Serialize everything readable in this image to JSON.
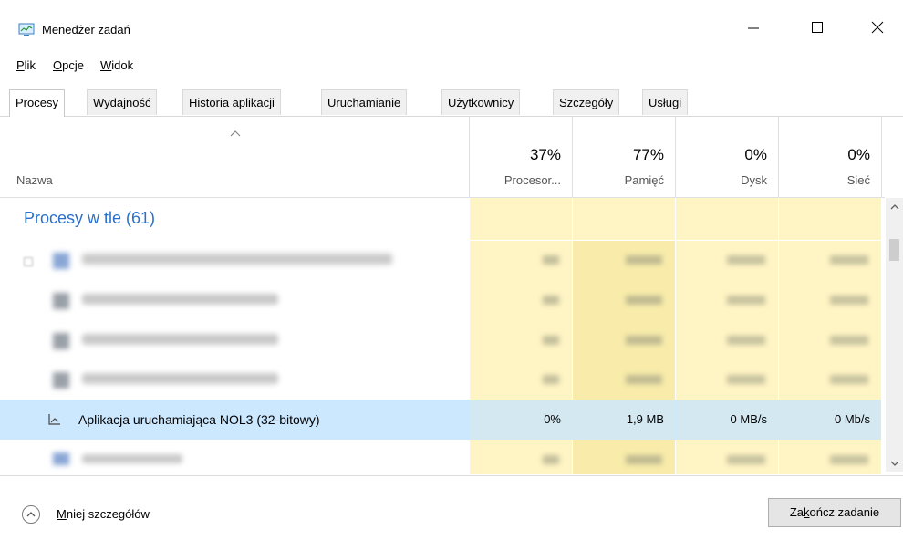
{
  "window": {
    "title": "Menedżer zadań",
    "controls": [
      "minimize-icon",
      "maximize-icon",
      "close-icon"
    ]
  },
  "menu": {
    "items": [
      {
        "label": "Plik",
        "accel": "P",
        "rest": "lik"
      },
      {
        "label": "Opcje",
        "accel": "O",
        "rest": "pcje"
      },
      {
        "label": "Widok",
        "accel": "W",
        "rest": "idok"
      }
    ]
  },
  "tabs": [
    {
      "label": "Procesy",
      "active": true
    },
    {
      "label": "Wydajność"
    },
    {
      "label": "Historia aplikacji"
    },
    {
      "label": "Uruchamianie"
    },
    {
      "label": "Użytkownicy"
    },
    {
      "label": "Szczegóły"
    },
    {
      "label": "Usługi"
    }
  ],
  "columns": {
    "name": {
      "label": "Nazwa"
    },
    "cpu": {
      "percent": "37%",
      "label": "Procesor..."
    },
    "memory": {
      "percent": "77%",
      "label": "Pamięć"
    },
    "disk": {
      "percent": "0%",
      "label": "Dysk"
    },
    "network": {
      "percent": "0%",
      "label": "Sieć"
    }
  },
  "group": {
    "label": "Procesy w tle (61)"
  },
  "rows": [
    {
      "name": "blurred-row-1",
      "blurred": true
    },
    {
      "name": "blurred-row-2",
      "blurred": true
    },
    {
      "name": "blurred-row-3",
      "blurred": true
    },
    {
      "name": "blurred-row-4",
      "blurred": true
    },
    {
      "name": "Aplikacja uruchamiająca NOL3 (32-bitowy)",
      "cpu": "0%",
      "memory": "1,9 MB",
      "disk": "0 MB/s",
      "network": "0 Mb/s",
      "selected": true
    },
    {
      "name": "blurred-row-6",
      "blurred": true
    }
  ],
  "footer": {
    "less_details": {
      "accel": "M",
      "rest": "niej szczegółów"
    },
    "end_task": {
      "before": "Za",
      "accel": "k",
      "after": "ończ zadanie"
    }
  },
  "colors": {
    "accent_blue": "#2a6fc9",
    "selection": "#cce8ff",
    "heat_light": "#fff4c4",
    "heat_mid": "#f9ecaa"
  }
}
